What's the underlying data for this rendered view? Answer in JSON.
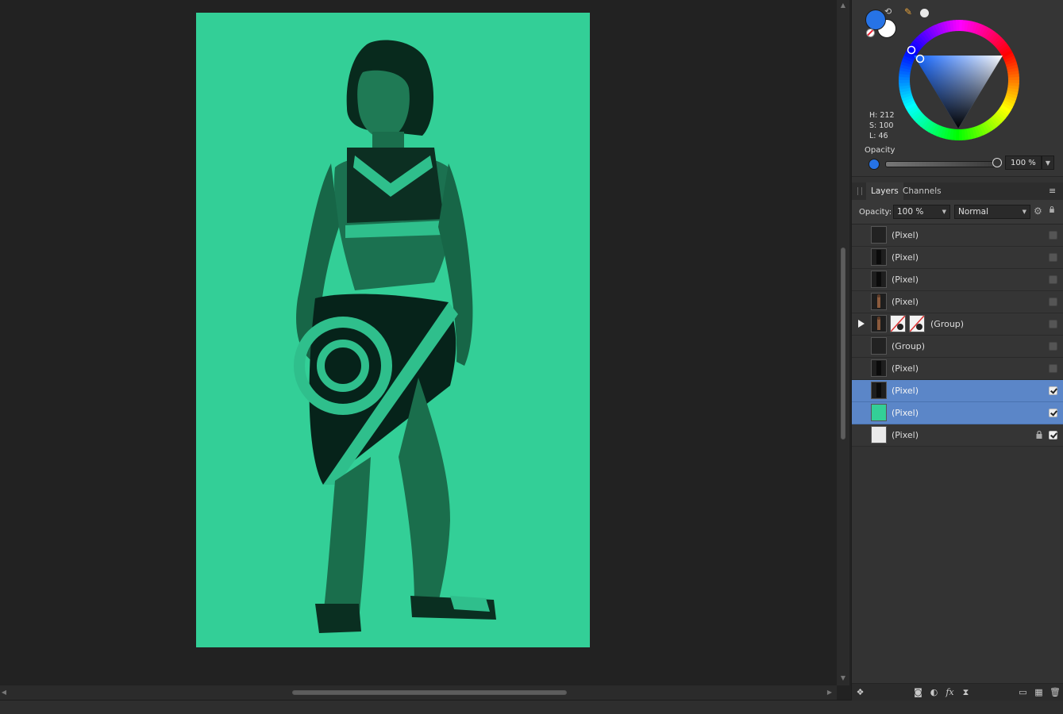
{
  "color_panel": {
    "primary_color": "#2673e6",
    "secondary_color": "#ffffff",
    "hue": "H: 212",
    "saturation": "S: 100",
    "lightness": "L: 46",
    "opacity_label": "Opacity",
    "opacity_value": "100 %",
    "opacity_fraction": 1.0
  },
  "tabs": {
    "layers": "Layers",
    "channels": "Channels"
  },
  "layer_toolbar": {
    "opacity_label": "Opacity:",
    "opacity_value": "100 %",
    "blend_mode": "Normal"
  },
  "layers": [
    {
      "name": "(Pixel)",
      "thumb": "dark",
      "selected": false,
      "visible": false,
      "locked": false,
      "expandable": false
    },
    {
      "name": "(Pixel)",
      "thumb": "figure-dark",
      "selected": false,
      "visible": false,
      "locked": false,
      "expandable": false
    },
    {
      "name": "(Pixel)",
      "thumb": "figure-dark",
      "selected": false,
      "visible": false,
      "locked": false,
      "expandable": false
    },
    {
      "name": "(Pixel)",
      "thumb": "figure",
      "selected": false,
      "visible": false,
      "locked": false,
      "expandable": false
    },
    {
      "name": "(Group)",
      "thumb": "figure",
      "selected": false,
      "visible": false,
      "locked": false,
      "expandable": true,
      "masks": 2
    },
    {
      "name": "(Group)",
      "thumb": "dark",
      "selected": false,
      "visible": false,
      "locked": false,
      "expandable": false
    },
    {
      "name": "(Pixel)",
      "thumb": "figure-dark",
      "selected": false,
      "visible": false,
      "locked": false,
      "expandable": false
    },
    {
      "name": "(Pixel)",
      "thumb": "figure-dark",
      "selected": true,
      "visible": true,
      "locked": false,
      "expandable": false
    },
    {
      "name": "(Pixel)",
      "thumb": "green",
      "selected": true,
      "visible": true,
      "locked": false,
      "expandable": false
    },
    {
      "name": "(Pixel)",
      "thumb": "white",
      "selected": false,
      "visible": true,
      "locked": true,
      "expandable": false
    }
  ],
  "colors": {
    "canvas_background": "#33cf97",
    "selection": "#5b86c8"
  }
}
